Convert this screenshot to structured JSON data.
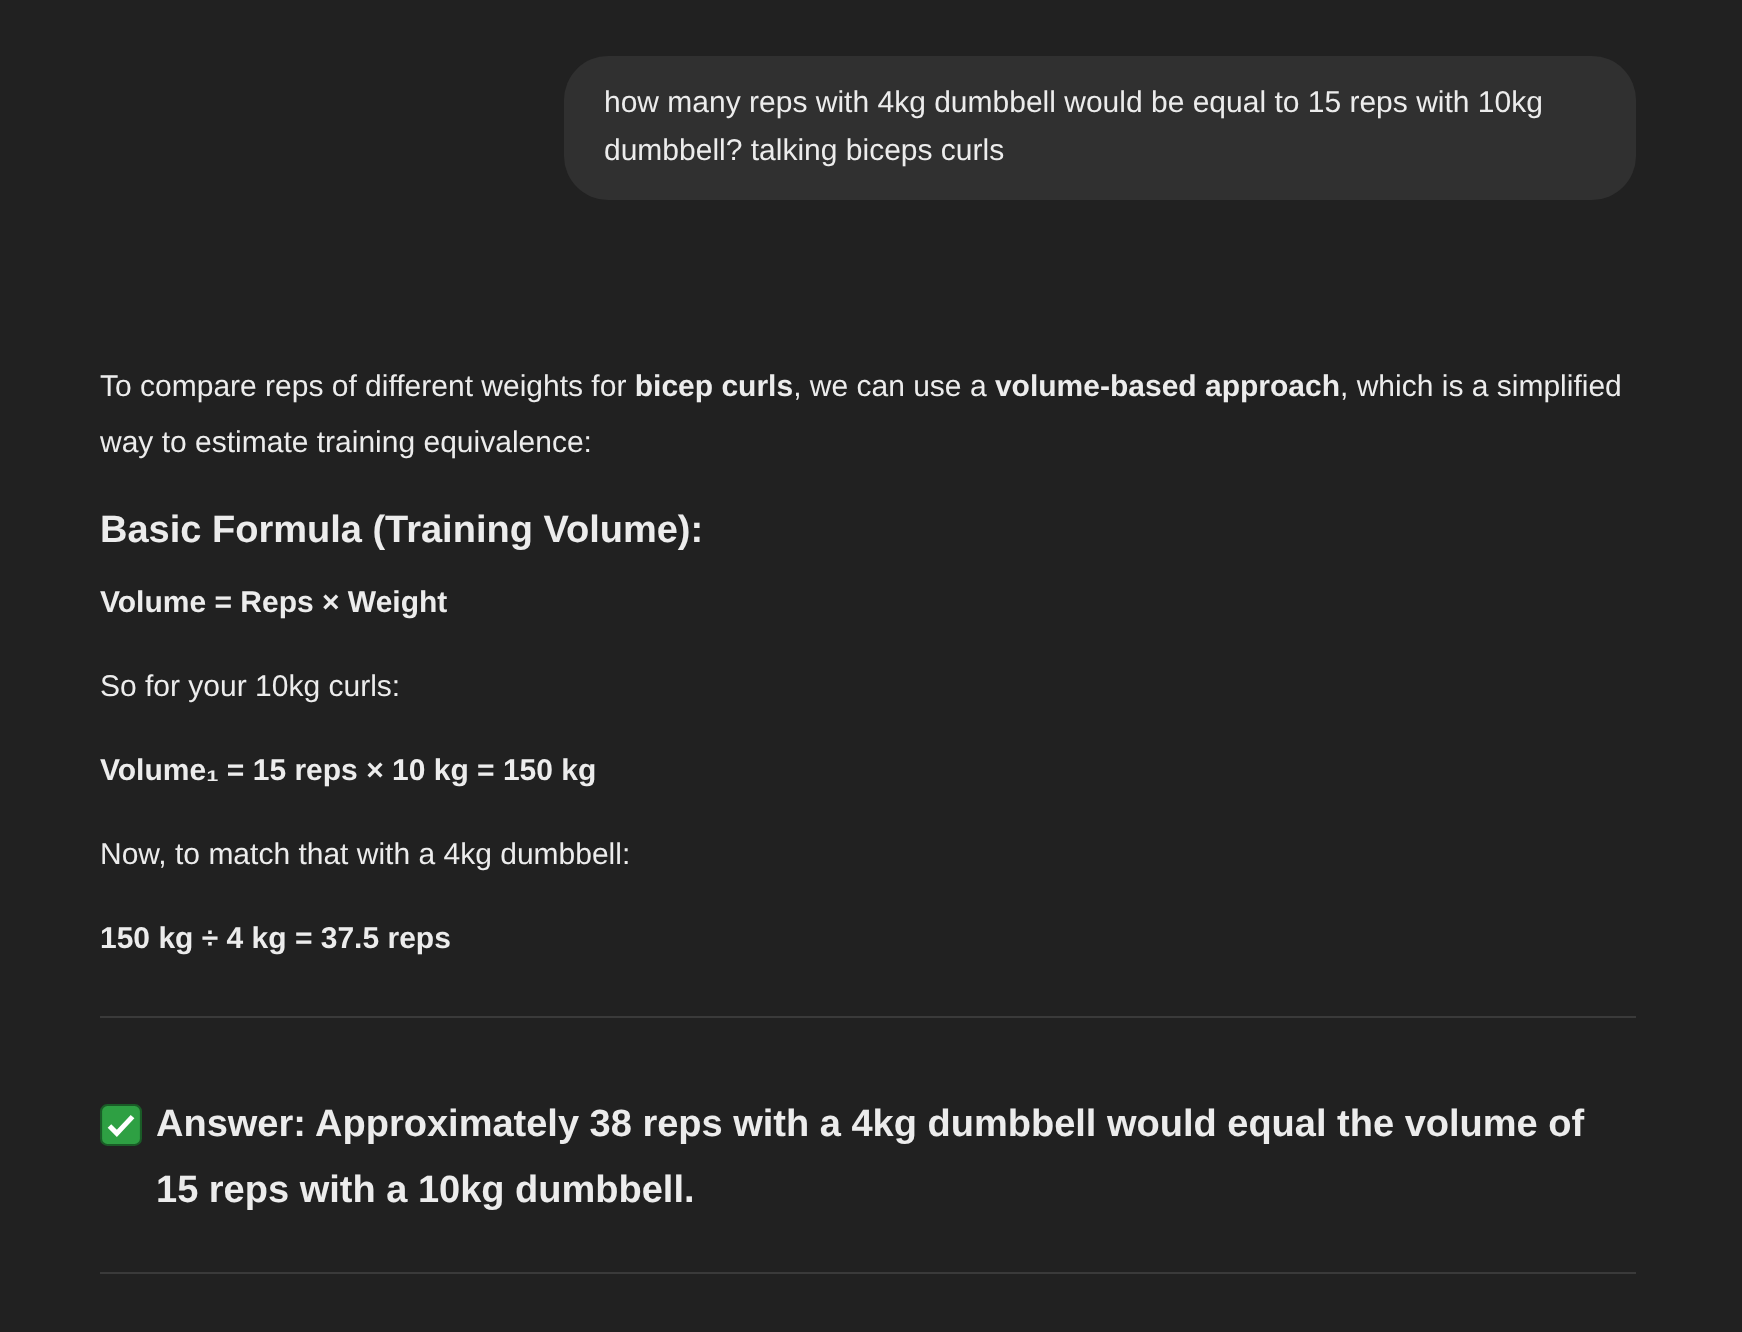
{
  "user_message": "how many reps with 4kg dumbbell would be equal to 15 reps with 10kg dumbbell? talking biceps curls",
  "response": [
    {
      "kind": "paragraph",
      "text": "To compare reps of different weights for **bicep curls**, we can use a **volume-based approach**, which is a simplified way to estimate training equivalence:"
    },
    {
      "kind": "heading",
      "text": "Basic Formula (Training Volume):"
    },
    {
      "kind": "paragraph",
      "text": "**Volume = Reps × Weight**"
    },
    {
      "kind": "paragraph",
      "text": "So for your 10kg curls:"
    },
    {
      "kind": "paragraph",
      "text": "**Volume₁ = 15 reps × 10 kg = 150 kg**"
    },
    {
      "kind": "paragraph",
      "text": "Now, to match that with a 4kg dumbbell:"
    },
    {
      "kind": "paragraph",
      "text": "**150 kg ÷ 4 kg = 37.5 reps**"
    },
    {
      "kind": "divider"
    },
    {
      "kind": "answer",
      "text": "**Answer: Approximately 38 reps** with a 4kg dumbbell would equal the volume of 15 reps with a 10kg dumbbell."
    },
    {
      "kind": "divider"
    }
  ]
}
